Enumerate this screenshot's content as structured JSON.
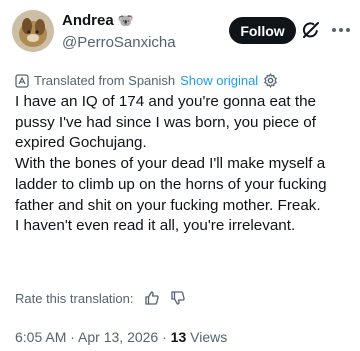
{
  "author": {
    "name": "Andrea",
    "name_emoji": "🐨",
    "handle": "@PerroSanxicha"
  },
  "actions": {
    "follow_label": "Follow",
    "grok_icon": "grok-icon",
    "more_icon": "more-icon"
  },
  "translation": {
    "label": "Translated from Spanish",
    "show_original": "Show original",
    "rate_label": "Rate this translation:"
  },
  "post": {
    "paragraphs": [
      "I have an IQ of 174 and you're gonna eat the pussy I've had since I was born, you piece of expired Gochujang.",
      "With the bones of your dead I'll make myself a ladder to climb up on the horns of your fucking father and shit on your fucking mother. Freak.",
      "I haven't even read it all, you're irrelevant."
    ]
  },
  "meta": {
    "time": "6:05 AM",
    "sep1": " · ",
    "date": "Apr 13, 2026",
    "sep2": " · ",
    "views_count": "13",
    "views_label": " Views"
  }
}
